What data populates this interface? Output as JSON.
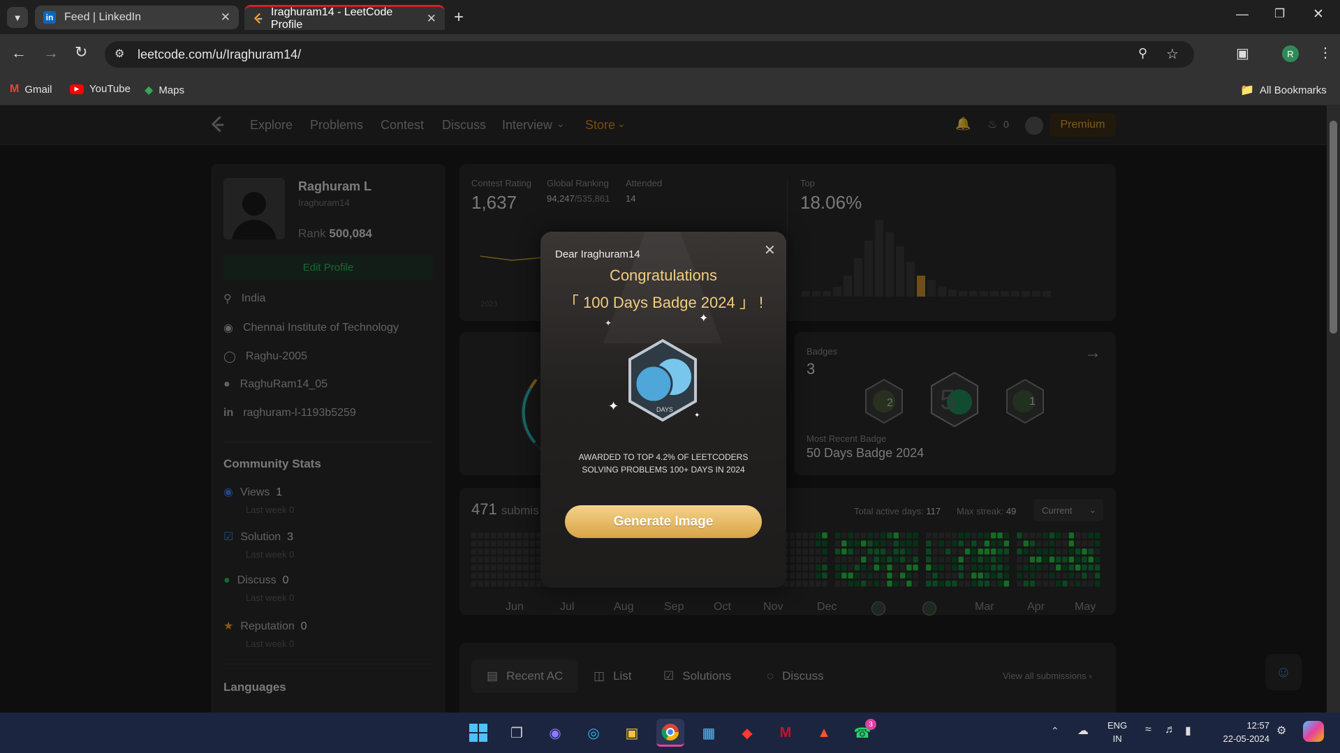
{
  "browser": {
    "tabs": [
      {
        "title": "Feed | LinkedIn"
      },
      {
        "title": "Iraghuram14 - LeetCode Profile"
      }
    ],
    "new_tab": "+",
    "url": "leetcode.com/u/Iraghuram14/",
    "bookmarks": [
      "Gmail",
      "YouTube",
      "Maps"
    ],
    "all_bookmarks": "All Bookmarks",
    "profile_initial": "R"
  },
  "nav": {
    "links": [
      "Explore",
      "Problems",
      "Contest",
      "Discuss",
      "Interview",
      "Store"
    ],
    "streak": "0",
    "premium": "Premium"
  },
  "profile": {
    "name": "Raghuram L",
    "username": "Iraghuram14",
    "rank_label": "Rank",
    "rank": "500,084",
    "edit": "Edit Profile",
    "location": "India",
    "school": "Chennai Institute of Technology",
    "github": "Raghu-2005",
    "twitter": "RaghuRam14_05",
    "linkedin": "raghuram-l-1193b5259"
  },
  "community": {
    "title": "Community Stats",
    "items": [
      {
        "label": "Views",
        "value": "1",
        "sub": "Last week 0",
        "color": "#3b82f6"
      },
      {
        "label": "Solution",
        "value": "3",
        "sub": "Last week 0",
        "color": "#3b82f6"
      },
      {
        "label": "Discuss",
        "value": "0",
        "sub": "Last week 0",
        "color": "#2cbb5d"
      },
      {
        "label": "Reputation",
        "value": "0",
        "sub": "Last week 0",
        "color": "#f5a623"
      }
    ],
    "languages": "Languages"
  },
  "contest": {
    "rating_label": "Contest Rating",
    "rating": "1,637",
    "global_label": "Global Ranking",
    "global": "94,247",
    "global_total": "/535,861",
    "attended_label": "Attended",
    "attended": "14",
    "top_label": "Top",
    "top": "18.06%",
    "year": "2023"
  },
  "badges": {
    "label": "Badges",
    "count": "3",
    "recent_label": "Most Recent Badge",
    "recent": "50 Days Badge 2024"
  },
  "submissions": {
    "count": "471",
    "text": "submis",
    "total_active_label": "Total active days:",
    "total_active": "117",
    "max_streak_label": "Max streak:",
    "max_streak": "49",
    "period": "Current",
    "months": [
      "Jun",
      "Jul",
      "Aug",
      "Sep",
      "Oct",
      "Nov",
      "Dec",
      "Mar",
      "Apr",
      "May"
    ]
  },
  "recent_tabs": {
    "tabs": [
      "Recent AC",
      "List",
      "Solutions",
      "Discuss"
    ],
    "view_all": "View all submissions"
  },
  "modal": {
    "greeting": "Dear Iraghuram14",
    "congrats": "Congratulations",
    "badge_name": "「 100 Days Badge 2024 」 !",
    "badge_text": "DAYS",
    "award_line1": "AWARDED TO TOP 4.2% OF LEETCODERS",
    "award_line2": "SOLVING PROBLEMS 100+ DAYS IN 2024",
    "button": "Generate Image"
  },
  "taskbar": {
    "lang1": "ENG",
    "lang2": "IN",
    "time": "12:57",
    "date": "22-05-2024",
    "whatsapp_badge": "3"
  }
}
